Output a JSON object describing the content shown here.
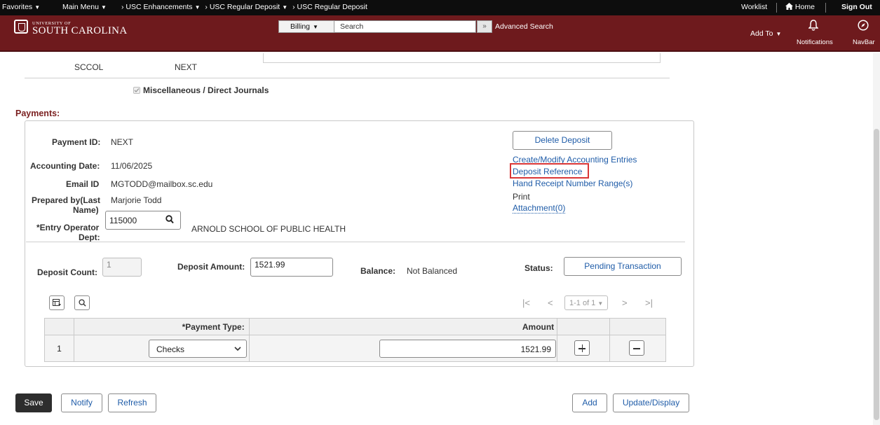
{
  "topnav": {
    "favorites": "Favorites",
    "main_menu": "Main Menu",
    "crumbs": [
      "USC Enhancements",
      "USC Regular Deposit",
      "USC Regular Deposit"
    ],
    "worklist": "Worklist",
    "home": "Home",
    "sign_out": "Sign Out"
  },
  "banner": {
    "logo_small": "UNIVERSITY OF",
    "logo_big": "SOUTH CAROLINA",
    "search_category": "Billing",
    "search_placeholder": "Search",
    "advanced_search": "Advanced Search",
    "add_to": "Add To",
    "notifications": "Notifications",
    "navbar": "NavBar"
  },
  "top_section": {
    "sccol_label": "SCCOL",
    "sccol_value": "NEXT",
    "misc_checkbox_label": "Miscellaneous / Direct Journals"
  },
  "payments": {
    "section_title": "Payments:",
    "payment_id_label": "Payment ID:",
    "payment_id": "NEXT",
    "accounting_date_label": "Accounting Date:",
    "accounting_date": "11/06/2025",
    "email_label": "Email ID",
    "email": "MGTODD@mailbox.sc.edu",
    "prepared_by_label_1": "Prepared by(Last",
    "prepared_by_label_2": "Name)",
    "prepared_by": "Marjorie Todd",
    "entry_dept_label_1": "*Entry Operator",
    "entry_dept_label_2": "Dept:",
    "entry_dept_value": "115000",
    "entry_dept_desc": "ARNOLD SCHOOL OF PUBLIC HEALTH",
    "delete_deposit": "Delete Deposit",
    "links": {
      "accounting_entries": "Create/Modify Accounting Entries",
      "deposit_reference": "Deposit Reference",
      "hand_receipt": "Hand Receipt Number Range(s)",
      "print": "Print",
      "attachment": "Attachment(0)"
    },
    "deposit_count_label": "Deposit Count:",
    "deposit_count": "1",
    "deposit_amount_label": "Deposit Amount:",
    "deposit_amount": "1521.99",
    "balance_label": "Balance:",
    "balance": "Not Balanced",
    "status_label": "Status:",
    "status": "Pending Transaction"
  },
  "grid": {
    "pagination": "1-1 of 1",
    "col_payment_type": "*Payment Type:",
    "col_amount": "Amount",
    "rows": [
      {
        "num": "1",
        "payment_type": "Checks",
        "amount": "1521.99"
      }
    ]
  },
  "footer": {
    "save": "Save",
    "notify": "Notify",
    "refresh": "Refresh",
    "add": "Add",
    "update_display": "Update/Display"
  },
  "colors": {
    "banner": "#6e1a1d",
    "section_title": "#7a1f1f",
    "link": "#1f5ca8",
    "highlight_box": "#d93636"
  }
}
